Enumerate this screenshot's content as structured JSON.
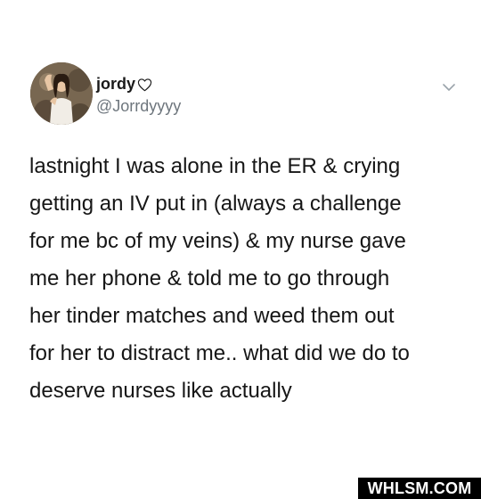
{
  "tweet": {
    "display_name": "jordy",
    "handle": "@Jorrdyyyy",
    "text": "lastnight I was alone in the ER & crying\ngetting an IV put in (always a challenge\nfor me bc of my veins) & my nurse gave\nme her phone & told me to go through\nher tinder matches and weed them out\nfor her to distract me.. what did we do to\ndeserve nurses like actually",
    "icons": {
      "heart": "heart-outline-icon",
      "menu": "chevron-down-icon"
    }
  },
  "watermark": {
    "text": "WHLSM.COM"
  },
  "colors": {
    "text": "#161616",
    "handle": "#6e767d",
    "watermark_bg": "#000000",
    "watermark_text": "#ffffff"
  }
}
